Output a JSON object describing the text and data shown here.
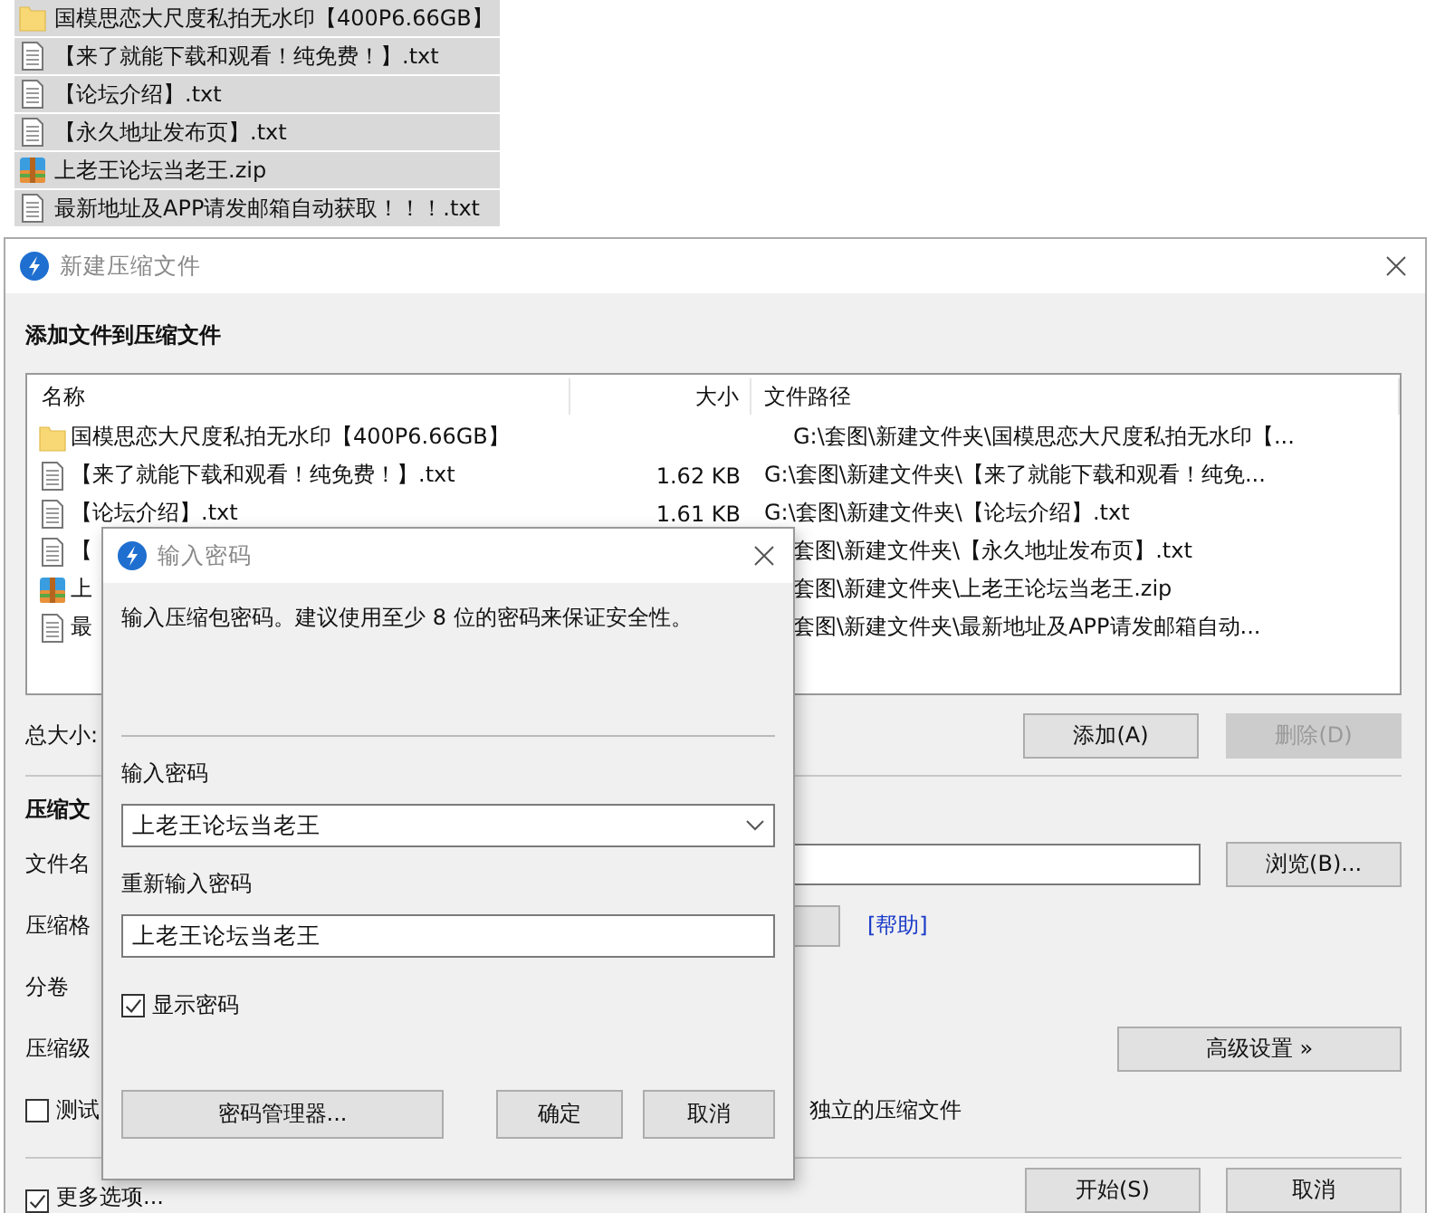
{
  "explorer_list": [
    {
      "kind": "folder",
      "name": "国模思恋大尺度私拍无水印【400P6.66GB】"
    },
    {
      "kind": "text",
      "name": "【来了就能下载和观看！纯免费！】.txt"
    },
    {
      "kind": "text",
      "name": "【论坛介绍】.txt"
    },
    {
      "kind": "text",
      "name": "【永久地址发布页】.txt"
    },
    {
      "kind": "archive",
      "name": "上老王论坛当老王.zip"
    },
    {
      "kind": "text",
      "name": "最新地址及APP请发邮箱自动获取！！！.txt"
    }
  ],
  "main_window": {
    "title": "新建压缩文件",
    "heading": "添加文件到压缩文件",
    "columns": [
      "名称",
      "大小",
      "文件路径"
    ],
    "rows": [
      {
        "kind": "folder",
        "name": "国模思恋大尺度私拍无水印【400P6.66GB】",
        "path": "G:\\套图\\新建文件夹\\国模思恋大尺度私拍无水印【..."
      },
      {
        "kind": "text",
        "name": "【来了就能下载和观看！纯免费！】.txt",
        "size": "1.62 KB",
        "path": "G:\\套图\\新建文件夹\\【来了就能下载和观看！纯免..."
      },
      {
        "kind": "text",
        "name": "【论坛介绍】.txt",
        "size": "1.61 KB",
        "path": "G:\\套图\\新建文件夹\\【论坛介绍】.txt"
      },
      {
        "kind": "text",
        "name": "【",
        "path": "套图\\新建文件夹\\【永久地址发布页】.txt"
      },
      {
        "kind": "archive",
        "name": "上",
        "path": "套图\\新建文件夹\\上老王论坛当老王.zip"
      },
      {
        "kind": "text",
        "name": "最",
        "path": "套图\\新建文件夹\\最新地址及APP请发邮箱自动..."
      }
    ],
    "total_label": "总大小:",
    "list_buttons": [
      {
        "label": "添加(A)",
        "disabled": false
      },
      {
        "label": "删除(D)",
        "disabled": true
      }
    ],
    "section_heading": "压缩文",
    "filename_label": "文件名",
    "browse_button": "浏览(B)...",
    "format_label": "压缩格",
    "help_link": "[帮助]",
    "volume_label": "分卷",
    "level_label": "压缩级",
    "advanced_button": "高级设置 »",
    "test_checkbox": {
      "label": "测试",
      "checked": false
    },
    "separate_text": "独立的压缩文件",
    "more_options": {
      "label": "更多选项...",
      "checked": true
    },
    "bottom_buttons": [
      "开始(S)",
      "取消"
    ]
  },
  "password_dialog": {
    "title": "输入密码",
    "description": "输入压缩包密码。建议使用至少 8 位的密码来保证安全性。",
    "password_label": "输入密码",
    "password": "上老王论坛当老王",
    "confirm_label": "重新输入密码",
    "confirm": "上老王论坛当老王",
    "show_password": {
      "label": "显示密码",
      "checked": true
    },
    "buttons": [
      "密码管理器...",
      "确定",
      "取消"
    ]
  }
}
